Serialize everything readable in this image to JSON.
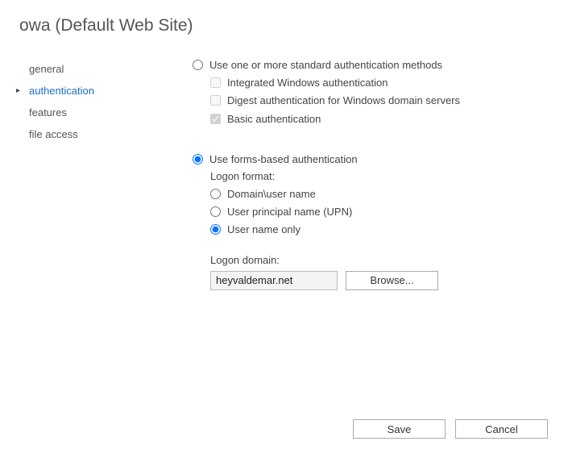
{
  "title": "owa (Default Web Site)",
  "sidebar": {
    "items": [
      {
        "label": "general"
      },
      {
        "label": "authentication"
      },
      {
        "label": "features"
      },
      {
        "label": "file access"
      }
    ],
    "selected_index": 1
  },
  "main": {
    "standard_auth": {
      "label": "Use one or more standard authentication methods",
      "selected": false,
      "options": [
        {
          "label": "Integrated Windows authentication",
          "checked": false
        },
        {
          "label": "Digest authentication for Windows domain servers",
          "checked": false
        },
        {
          "label": "Basic authentication",
          "checked": true
        }
      ]
    },
    "forms_auth": {
      "label": "Use forms-based authentication",
      "selected": true,
      "logon_format_label": "Logon format:",
      "options": [
        {
          "label": "Domain\\user name",
          "selected": false
        },
        {
          "label": "User principal name (UPN)",
          "selected": false
        },
        {
          "label": "User name only",
          "selected": true
        }
      ],
      "logon_domain_label": "Logon domain:",
      "logon_domain_value": "heyvaldemar.net",
      "browse_label": "Browse..."
    }
  },
  "footer": {
    "save": "Save",
    "cancel": "Cancel"
  }
}
